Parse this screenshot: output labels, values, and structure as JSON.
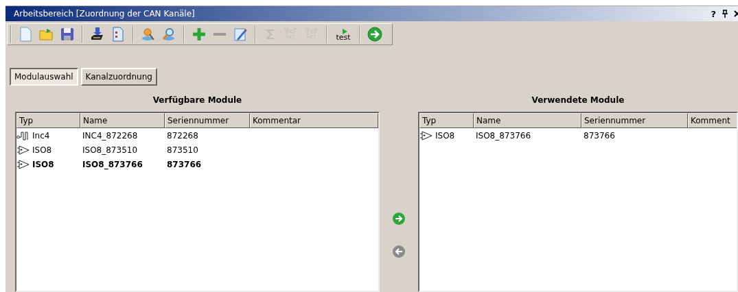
{
  "window": {
    "title": "Arbeitsbereich [Zuordnung der CAN Kanäle]",
    "help": "?"
  },
  "toolbar": {
    "groups": [
      [
        {
          "disabled": false
        },
        {
          "disabled": false
        },
        {
          "disabled": false
        }
      ],
      [
        {
          "disabled": false
        },
        {
          "disabled": false
        }
      ],
      [
        {
          "disabled": false
        },
        {
          "disabled": false
        }
      ],
      [
        {
          "disabled": false
        },
        {
          "disabled": false
        },
        {
          "disabled": false
        }
      ],
      [
        {
          "disabled": true
        },
        {
          "disabled": true
        },
        {
          "disabled": true
        }
      ],
      [
        {
          "disabled": false,
          "label": "test"
        }
      ],
      [
        {
          "disabled": false
        }
      ]
    ]
  },
  "tabs": [
    {
      "label": "Modulauswahl",
      "selected": true
    },
    {
      "label": "Kanalzuordnung",
      "selected": false
    }
  ],
  "tables": [
    {
      "title": "Verfügbare Module",
      "columns": [
        "Typ",
        "Name",
        "Seriennummer",
        "Kommentar"
      ],
      "rows": [
        {
          "kind": "encoder",
          "type": "Inc4",
          "name": "INC4_872268",
          "serial": "872268",
          "in_use": false
        },
        {
          "kind": "amplifier",
          "type": "ISO8",
          "name": "ISO8_873510",
          "serial": "873510",
          "in_use": false
        },
        {
          "kind": "amplifier",
          "type": "ISO8",
          "name": "ISO8_873766",
          "serial": "873766",
          "in_use": true
        }
      ]
    },
    {
      "title": "Verwendete Module",
      "columns": [
        "Typ",
        "Name",
        "Seriennummer",
        "Komment"
      ],
      "rows": [
        {
          "kind": "amplifier",
          "type": "ISO8",
          "name": "ISO8_873766",
          "serial": "873766",
          "in_use": false
        }
      ]
    }
  ],
  "transfer": {
    "add": {
      "disabled": false
    },
    "remove": {
      "disabled": true
    }
  }
}
